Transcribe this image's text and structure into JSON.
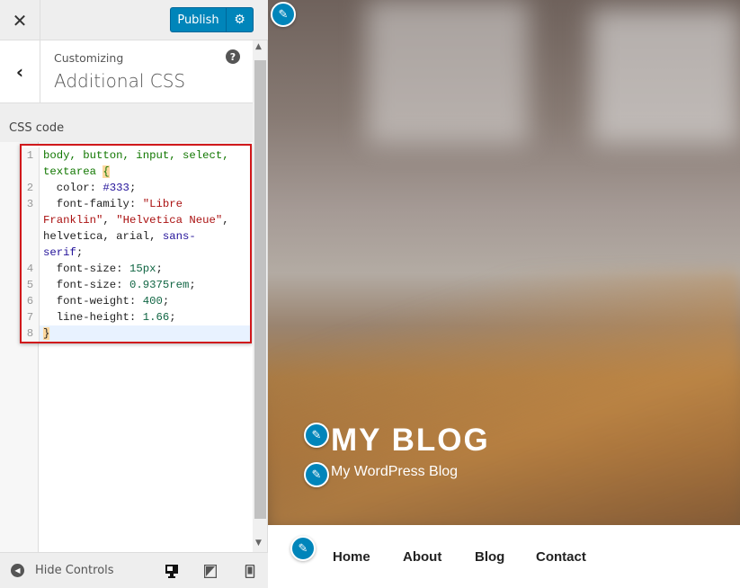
{
  "header": {
    "close_icon": "close-icon",
    "publish_label": "Publish",
    "settings_icon": "gear-icon"
  },
  "section": {
    "breadcrumb": "Customizing",
    "title": "Additional CSS",
    "help_icon": "?"
  },
  "editor": {
    "label": "CSS code",
    "lines": [
      {
        "num": "1",
        "text": "body, button, input, select,"
      },
      {
        "num": "",
        "text": "textarea {"
      },
      {
        "num": "2",
        "text": "  color: #333;"
      },
      {
        "num": "3",
        "text": "  font-family: \"Libre"
      },
      {
        "num": "",
        "text": "Franklin\", \"Helvetica Neue\","
      },
      {
        "num": "",
        "text": "helvetica, arial, sans-"
      },
      {
        "num": "",
        "text": "serif;"
      },
      {
        "num": "4",
        "text": "  font-size: 15px;"
      },
      {
        "num": "5",
        "text": "  font-size: 0.9375rem;"
      },
      {
        "num": "6",
        "text": "  font-weight: 400;"
      },
      {
        "num": "7",
        "text": "  line-height: 1.66;"
      },
      {
        "num": "8",
        "text": "}"
      }
    ]
  },
  "footer": {
    "hide_controls": "Hide Controls",
    "devices": [
      "desktop",
      "tablet",
      "mobile"
    ]
  },
  "preview": {
    "site_title": "MY BLOG",
    "tagline": "My WordPress Blog",
    "nav": [
      "Home",
      "About",
      "Blog",
      "Contact"
    ]
  },
  "colors": {
    "accent": "#0085ba",
    "highlight_border": "#d0181b"
  }
}
